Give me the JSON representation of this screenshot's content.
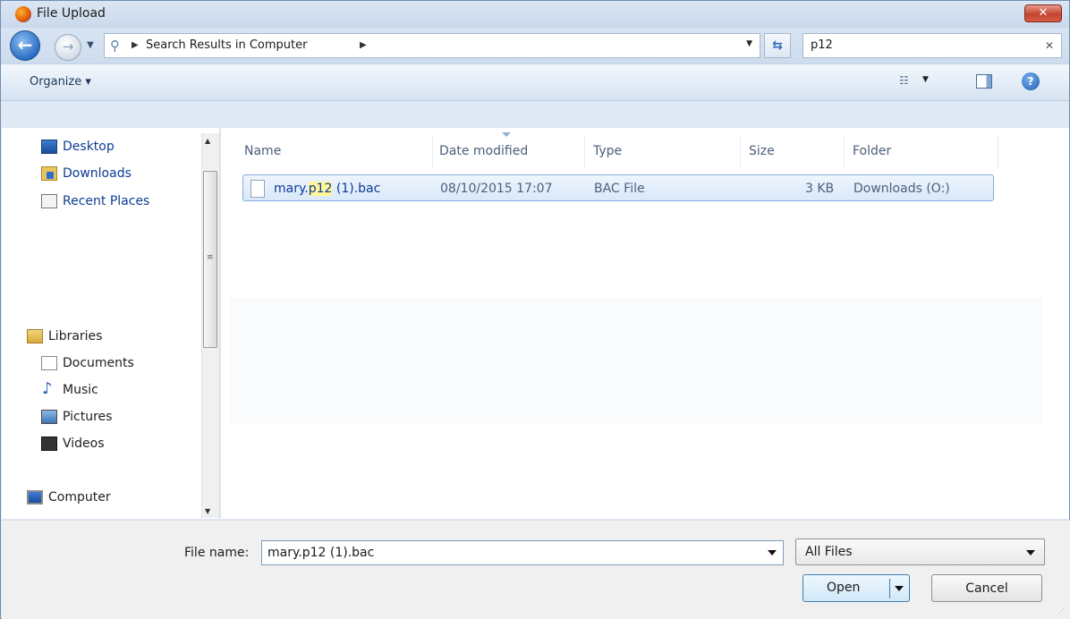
{
  "window": {
    "title": "File Upload",
    "close_label": "✕"
  },
  "nav": {
    "address": {
      "crumb": "Search Results in Computer"
    },
    "search": {
      "value": "p12",
      "clear_label": "✕"
    }
  },
  "toolbar": {
    "organize_label": "Organize ▾"
  },
  "sidebar": {
    "favorites": [
      {
        "label": "Desktop",
        "icon": "desktop-icon"
      },
      {
        "label": "Downloads",
        "icon": "downloads-folder-icon"
      },
      {
        "label": "Recent Places",
        "icon": "recent-places-icon"
      }
    ],
    "libraries": {
      "label": "Libraries",
      "icon": "libraries-icon"
    },
    "library_items": [
      {
        "label": "Documents",
        "icon": "documents-icon"
      },
      {
        "label": "Music",
        "icon": "music-icon"
      },
      {
        "label": "Pictures",
        "icon": "pictures-icon"
      },
      {
        "label": "Videos",
        "icon": "videos-icon"
      }
    ],
    "computer": {
      "label": "Computer",
      "icon": "computer-icon"
    }
  },
  "filelist": {
    "columns": [
      "Name",
      "Date modified",
      "Type",
      "Size",
      "Folder"
    ],
    "rows": [
      {
        "name_pre": "mary.",
        "name_match": "p12",
        "name_post": " (1).bac",
        "date_modified": "08/10/2015 17:07",
        "type": "BAC File",
        "size": "3 KB",
        "folder": "Downloads (O:)"
      }
    ]
  },
  "footer": {
    "filename_label": "File name:",
    "filename_value": "mary.p12 (1).bac",
    "filetype_value": "All Files",
    "open_label": "Open",
    "cancel_label": "Cancel"
  }
}
